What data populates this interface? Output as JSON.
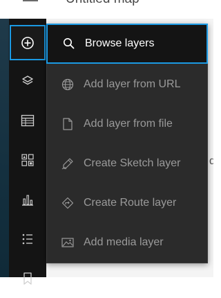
{
  "header": {
    "title": "Untitled map"
  },
  "toolbar": {
    "items": [
      {
        "name": "add",
        "icon": "plus-circle-icon"
      },
      {
        "name": "layers",
        "icon": "layers-icon"
      },
      {
        "name": "table",
        "icon": "table-icon"
      },
      {
        "name": "legend",
        "icon": "legend-icon"
      },
      {
        "name": "charts",
        "icon": "bar-chart-icon"
      },
      {
        "name": "list",
        "icon": "list-icon"
      },
      {
        "name": "bookmarks",
        "icon": "bookmark-icon"
      }
    ]
  },
  "menu": {
    "items": [
      {
        "label": "Browse layers",
        "icon": "search-icon",
        "state": "active"
      },
      {
        "label": "Add layer from URL",
        "icon": "globe-icon",
        "state": "disabled"
      },
      {
        "label": "Add layer from file",
        "icon": "file-icon",
        "state": "disabled"
      },
      {
        "label": "Create Sketch layer",
        "icon": "pencil-icon",
        "state": "disabled"
      },
      {
        "label": "Create Route layer",
        "icon": "route-icon",
        "state": "disabled"
      },
      {
        "label": "Add media layer",
        "icon": "image-icon",
        "state": "disabled"
      }
    ]
  },
  "colors": {
    "accent": "#1b9ae4",
    "menu_bg": "#2b2b2b",
    "toolbar_bg": "#141414",
    "disabled_text": "#9a9a9a"
  }
}
